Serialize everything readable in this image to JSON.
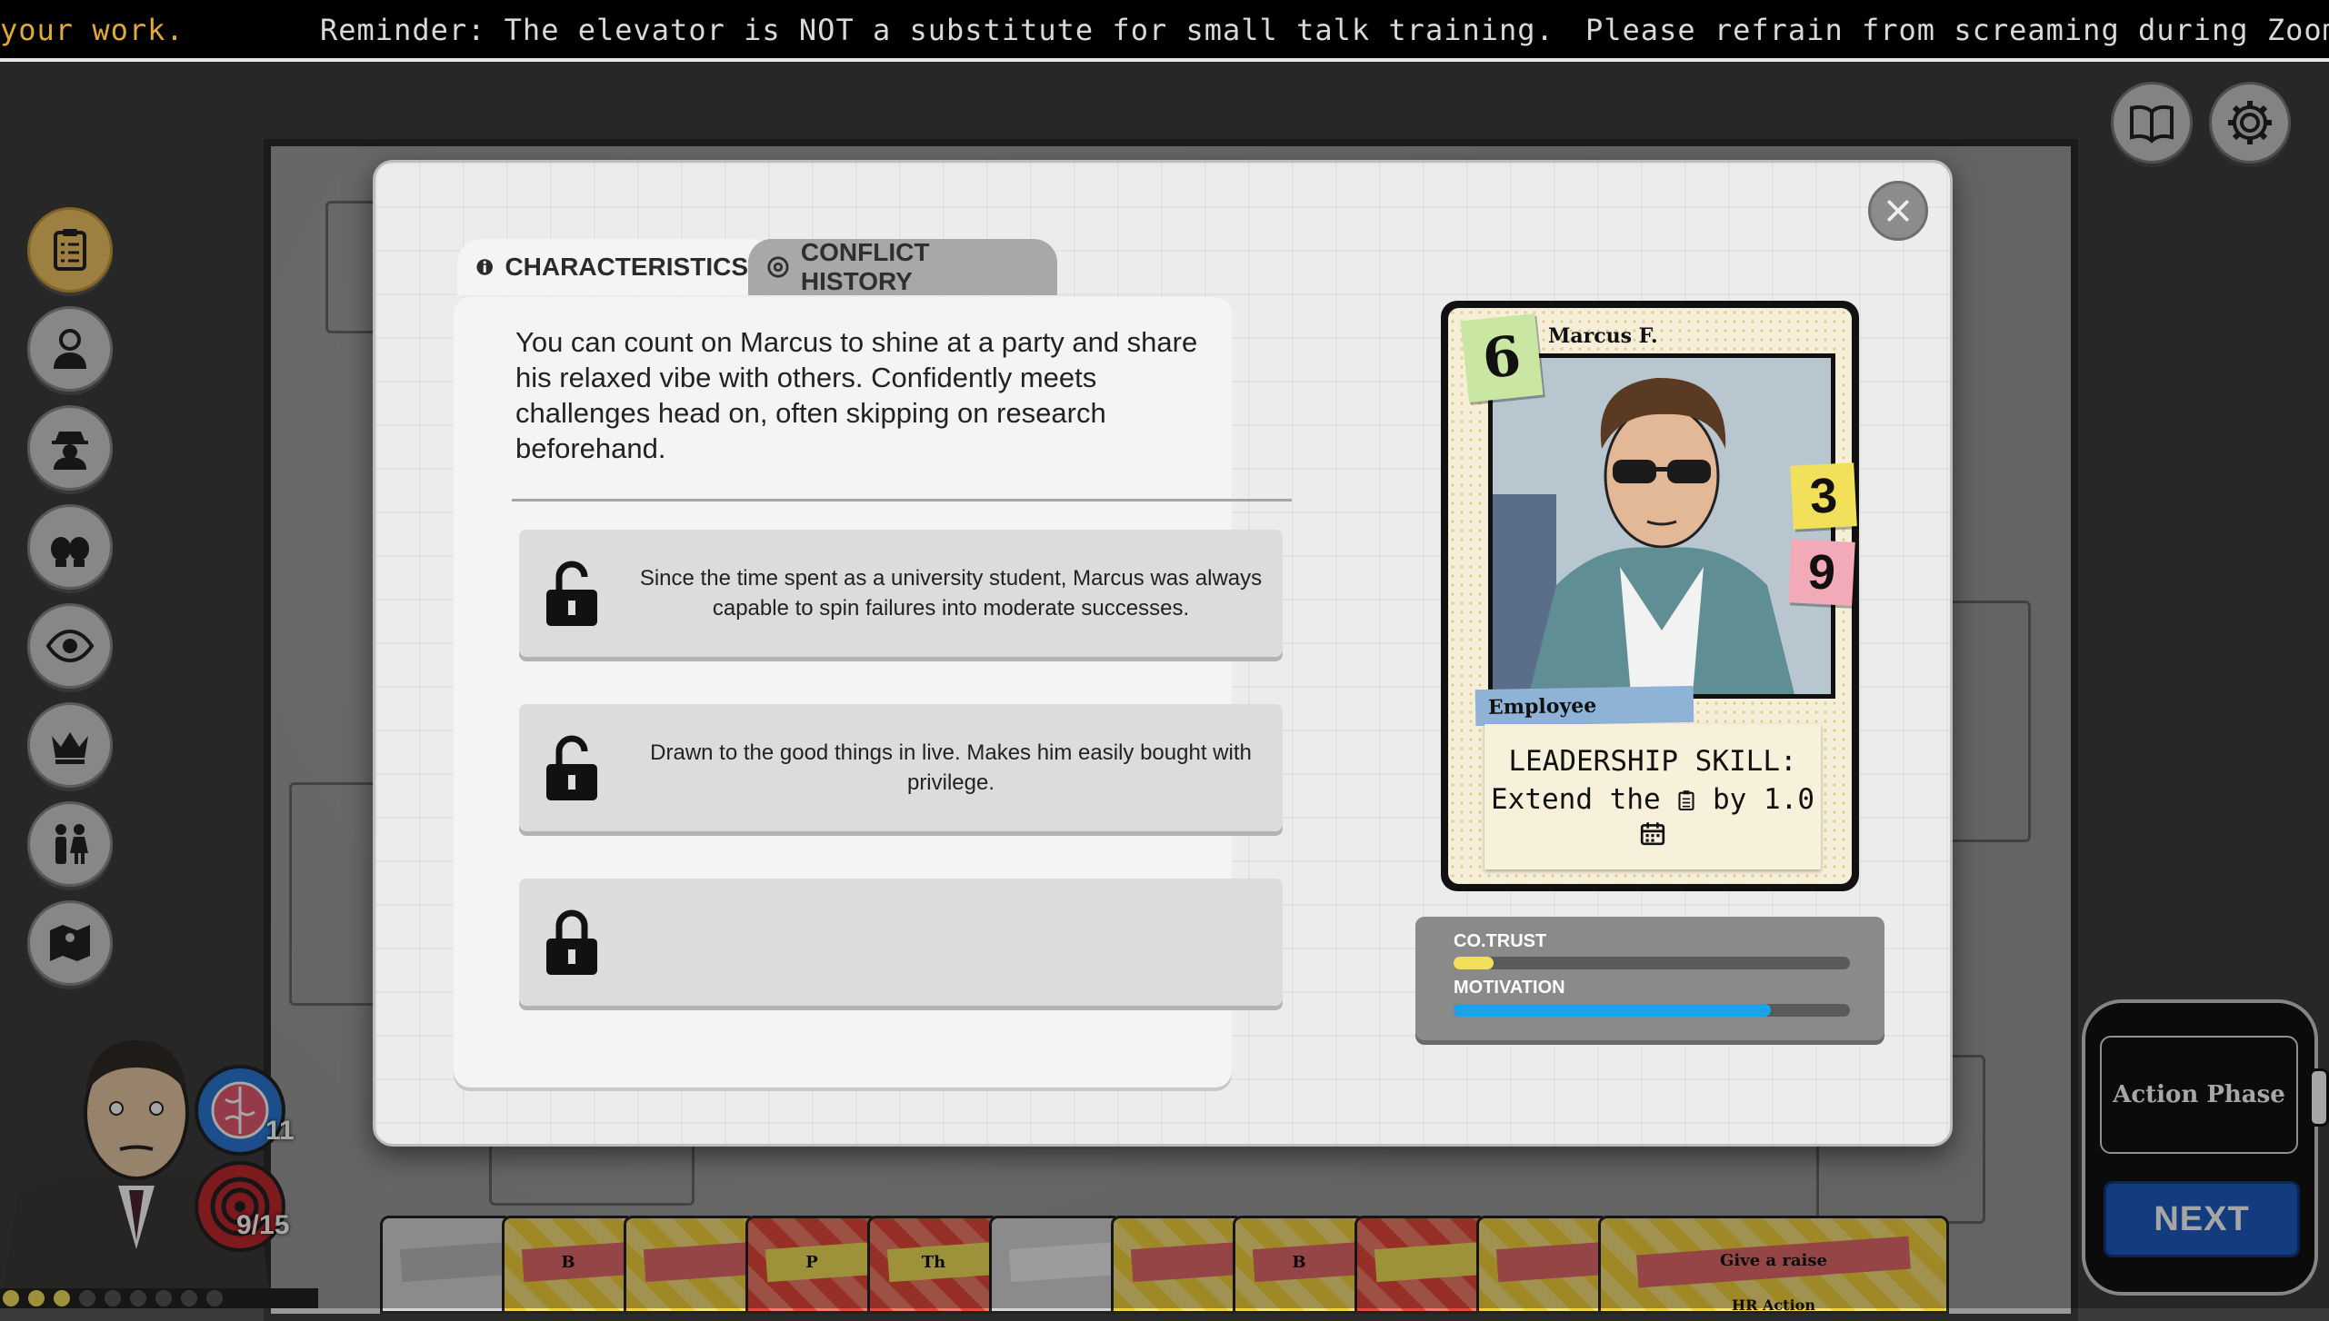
{
  "ticker": {
    "items": [
      "your work.",
      "Reminder: The elevator is NOT a substitute for small talk training.",
      "Please refrain from screaming during Zoom"
    ]
  },
  "sidebar": {
    "items": [
      {
        "name": "clipboard-icon",
        "active": true
      },
      {
        "name": "employee-icon",
        "active": false
      },
      {
        "name": "spy-icon",
        "active": false
      },
      {
        "name": "boxing-gloves-icon",
        "active": false
      },
      {
        "name": "eye-icon",
        "active": false
      },
      {
        "name": "crown-icon",
        "active": false
      },
      {
        "name": "people-icon",
        "active": false
      },
      {
        "name": "map-icon",
        "active": false
      }
    ]
  },
  "top_right": {
    "book_icon": "book-icon",
    "settings_icon": "gear-icon"
  },
  "modal": {
    "tabs": [
      {
        "label": "CHARACTERISTICS",
        "icon": "info-icon",
        "active": true
      },
      {
        "label": "CONFLICT HISTORY",
        "icon": "history-icon",
        "active": false
      }
    ],
    "description": "You can count on Marcus to shine at a party and share his relaxed vibe with others. Confidently meets challenges head on, often skipping on research beforehand.",
    "traits": [
      {
        "text": "Since the time spent as a university student, Marcus was always capable to spin failures into moderate successes.",
        "locked": false
      },
      {
        "text": "Drawn to the good things in live. Makes him easily bought with privilege.",
        "locked": false
      },
      {
        "text": "",
        "locked": true
      }
    ]
  },
  "card": {
    "cost": "6",
    "name": "Marcus F.",
    "stat_yellow": "3",
    "stat_pink": "9",
    "role": "Employee",
    "skill_line1": "LEADERSHIP SKILL:",
    "skill_line2a": "Extend the",
    "skill_line2b": "by 1.0"
  },
  "bars": {
    "trust_label": "CO.TRUST",
    "trust_value": 0.1,
    "trust_color": "#f2e05a",
    "motivation_label": "MOTIVATION",
    "motivation_value": 0.8,
    "motivation_color": "#1aa3e8"
  },
  "boss": {
    "brain_value": "11",
    "target_value": "9/15",
    "brain_color": "#2a79d6",
    "target_color": "#c0282d"
  },
  "hand": {
    "cards": [
      "",
      "B",
      "",
      "P",
      "Th",
      "",
      "",
      "B",
      "",
      "",
      "Give a raise"
    ],
    "last_sub": "HR Action"
  },
  "phase": {
    "title": "Action Phase",
    "next_label": "NEXT"
  }
}
